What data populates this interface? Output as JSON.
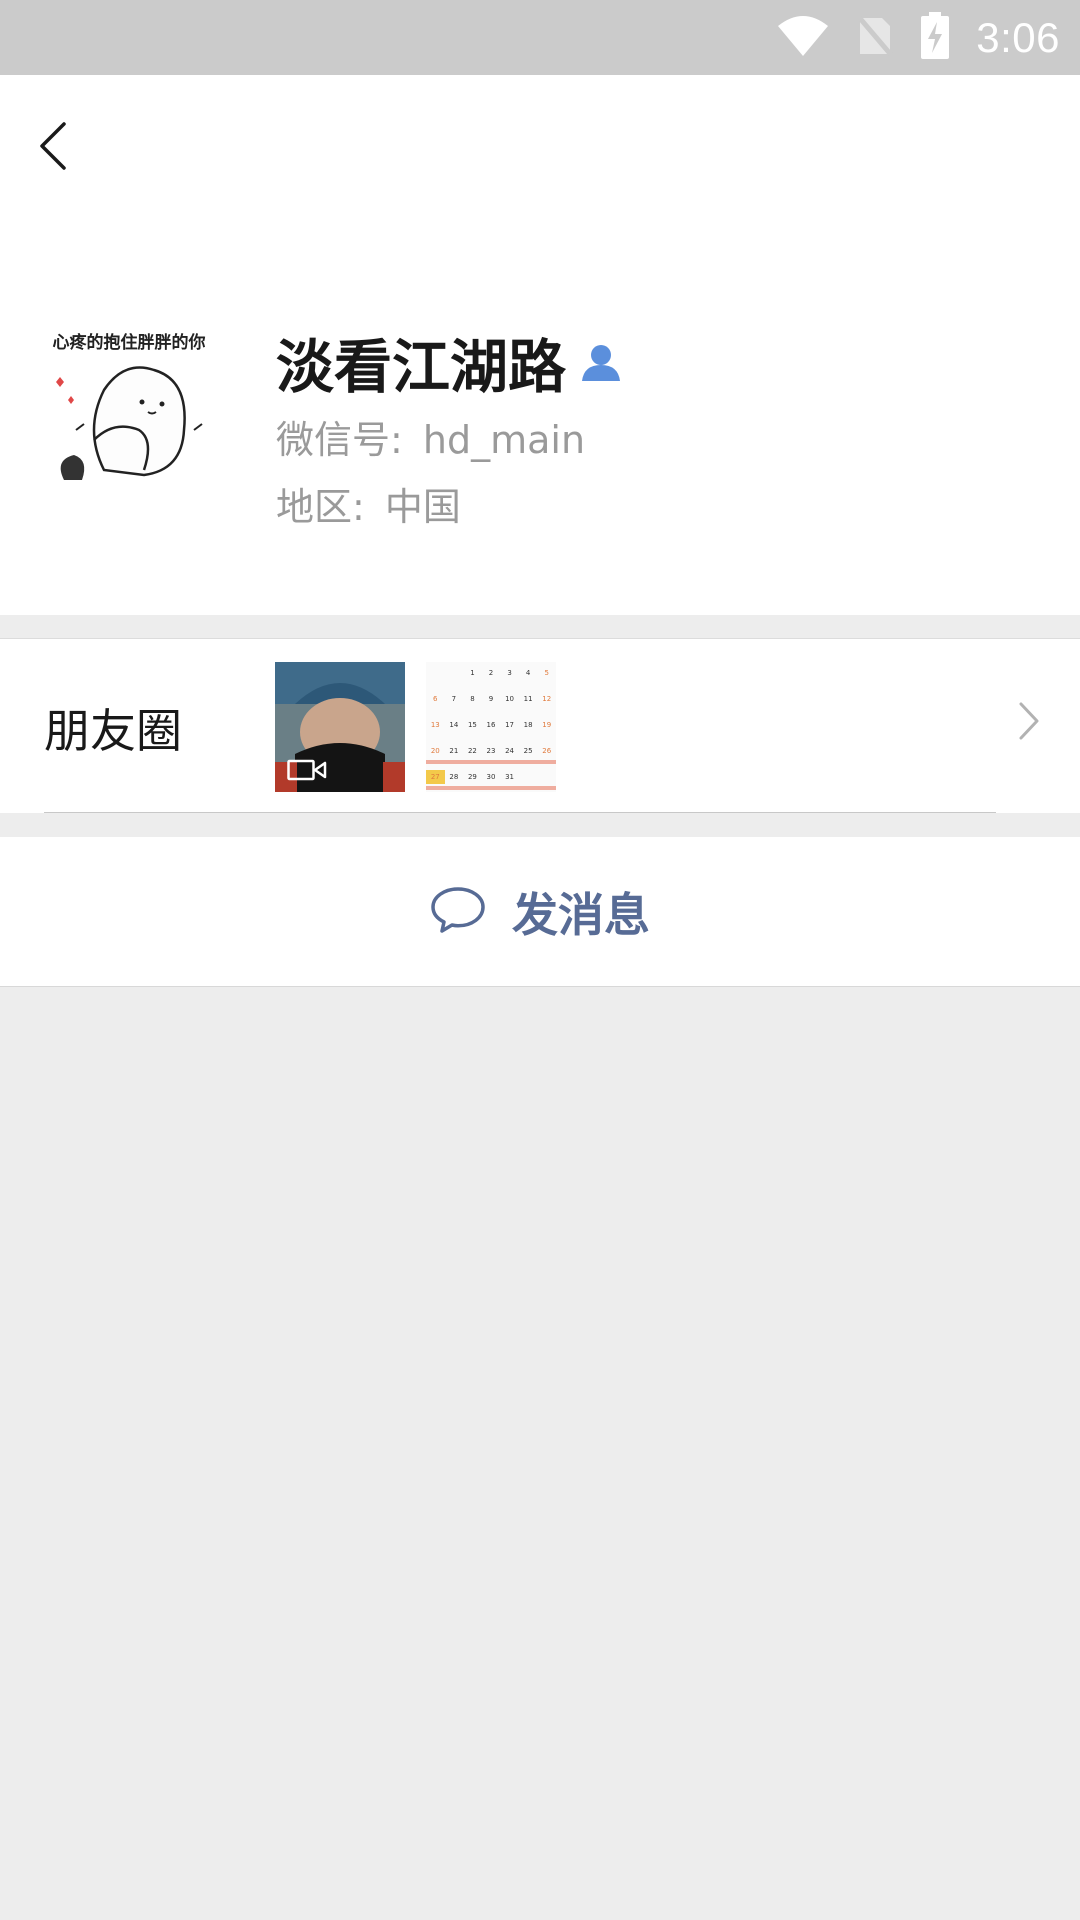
{
  "status_bar": {
    "time": "3:06",
    "icons": [
      "wifi-icon",
      "no-sim-icon",
      "battery-charging-icon"
    ]
  },
  "header": {
    "back_icon": "back-arrow-icon"
  },
  "profile": {
    "avatar_caption": "心疼的抱住胖胖的你",
    "name": "淡看江湖路",
    "gender_icon": "male-user-icon",
    "wechat_id_label": "微信号:",
    "wechat_id_value": "hd_main",
    "region_label": "地区:",
    "region_value": "中国"
  },
  "moments": {
    "label": "朋友圈",
    "thumbnails": [
      {
        "type": "video",
        "icon": "video-camera-icon"
      },
      {
        "type": "image",
        "content": "calendar",
        "calendar_rows": [
          [
            "",
            "",
            "1",
            "2",
            "3",
            "4",
            "5"
          ],
          [
            "6",
            "7",
            "8",
            "9",
            "10",
            "11",
            "12"
          ],
          [
            "13",
            "14",
            "15",
            "16",
            "17",
            "18",
            "19"
          ],
          [
            "20",
            "21",
            "22",
            "23",
            "24",
            "25",
            "26"
          ],
          [
            "27",
            "28",
            "29",
            "30",
            "31",
            "",
            ""
          ]
        ]
      }
    ],
    "chevron_icon": "chevron-right-icon"
  },
  "actions": {
    "send_message_label": "发消息",
    "send_message_icon": "chat-bubble-icon"
  },
  "colors": {
    "link_blue": "#576b95",
    "gender_blue": "#5b8fdc",
    "status_bar_bg": "#cbcbcb",
    "page_bg": "#ededed"
  }
}
